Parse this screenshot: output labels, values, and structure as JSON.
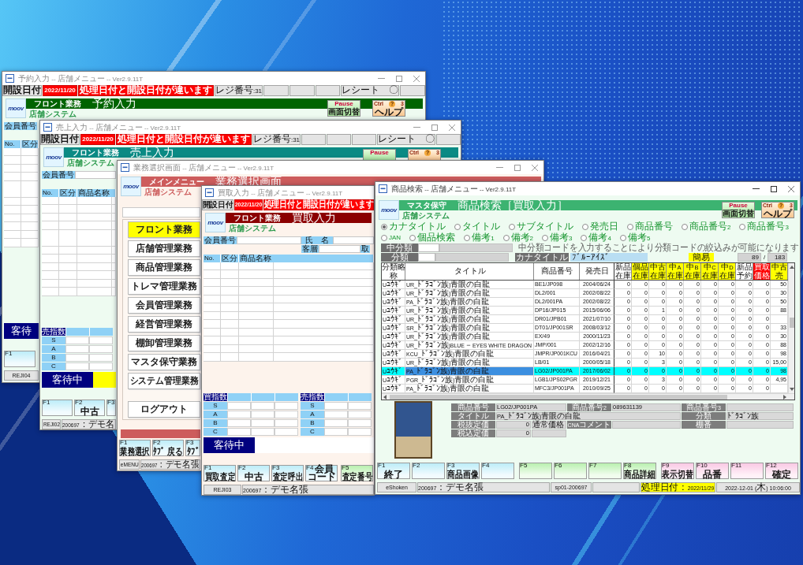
{
  "windows": [
    {
      "kind": "sales",
      "active": false,
      "title": "予約入力 -- 店舗メニュー -- Ver2.9.11T",
      "title_buttons": true,
      "info_bar": [
        {
          "kind": "label",
          "text": "開設日付"
        },
        {
          "kind": "alert",
          "text": "2022/11/20"
        },
        {
          "kind": "alert",
          "text": "処理日付と開設日付が違います"
        },
        {
          "kind": "plain",
          "text": "レジ番号:31"
        },
        {
          "kind": "empty"
        },
        {
          "kind": "empty"
        },
        {
          "kind": "empty"
        },
        {
          "kind": "plain",
          "text": "レシート　〇"
        },
        {
          "kind": "empty"
        }
      ],
      "header": {
        "logo": "moov",
        "module": "フロント業務",
        "screen": "予約入力",
        "system": "店舗システム",
        "color": "#006400",
        "buttons": [
          {
            "kind": "pause",
            "key": "Pause",
            "label": "画面切替"
          },
          {
            "kind": "help",
            "key": "Ctrl",
            "mark": "?",
            "number": "3",
            "label": "ヘルプ"
          }
        ]
      },
      "member_rows": [
        [
          {
            "label": "会員番号",
            "input": false
          }
        ]
      ],
      "table": {
        "columns": [
          "No.",
          "区分"
        ]
      },
      "customer_status": {
        "text": "客待"
      },
      "function_keys": [
        [
          {
            "key": "F1"
          }
        ]
      ],
      "status_bar": [
        {
          "kind": "plain",
          "text": "REJI04"
        }
      ]
    },
    {
      "kind": "sales",
      "active": false,
      "title": "売上入力 -- 店舗メニュー -- Ver2.9.11T",
      "title_buttons": true,
      "info_bar": [
        {
          "kind": "label",
          "text": "開設日付"
        },
        {
          "kind": "alert",
          "text": "2022/11/20"
        },
        {
          "kind": "alert",
          "text": "処理日付と開設日付が違います"
        },
        {
          "kind": "plain",
          "text": "レジ番号:31"
        },
        {
          "kind": "empty"
        },
        {
          "kind": "empty"
        },
        {
          "kind": "empty"
        },
        {
          "kind": "plain",
          "text": "レシート　〇"
        },
        {
          "kind": "empty"
        }
      ],
      "header": {
        "logo": "moov",
        "module": "フロント業務",
        "screen": "売上入力",
        "system": "店舗システム",
        "color": "#0a8a84",
        "buttons": [
          {
            "kind": "pause",
            "key": "Pause"
          },
          {
            "kind": "help",
            "key": "Ctrl",
            "mark": "?",
            "number": "3"
          }
        ]
      },
      "member_rows": [
        [
          {
            "label": "会員番号",
            "input": true
          }
        ]
      ],
      "table": {
        "columns": [
          "No.",
          "区分",
          "商品名称"
        ]
      },
      "indices": [
        {
          "title": "売指数",
          "rows": [
            "S",
            "A",
            "B",
            "C"
          ]
        }
      ],
      "customer_status": {
        "text": "客待中",
        "highlight": true
      },
      "function_keys": [
        [
          {
            "key": "F1"
          },
          {
            "key": "F2",
            "label": "中古"
          },
          {
            "key": "F3"
          }
        ]
      ],
      "status_bar": [
        {
          "kind": "plain",
          "text": "REJI02"
        },
        {
          "kind": "plain",
          "text": "200697：デモ名"
        }
      ]
    },
    {
      "kind": "menu",
      "active": false,
      "title": "業務選択画面 -- 店舗メニュー -- Ver2.9.11T",
      "title_buttons": true,
      "header": {
        "logo": "moov",
        "module": "メインメニュー",
        "screen": "業務選択画面",
        "system": "店舗システム",
        "color": "#cd5c5c"
      },
      "menu": [
        {
          "label": "フロント業務",
          "selected": true
        },
        {
          "label": "店舗管理業務",
          "selected": false
        },
        {
          "label": "商品管理業務",
          "selected": false
        },
        {
          "label": "トレマ管理業務",
          "selected": false
        },
        {
          "label": "会員管理業務",
          "selected": false
        },
        {
          "label": "経営管理業務",
          "selected": false
        },
        {
          "label": "棚卸管理業務",
          "selected": false
        },
        {
          "label": "マスタ保守業務",
          "selected": false
        },
        {
          "label": "システム管理業務",
          "selected": false
        }
      ],
      "logout": {
        "label": "ログアウト"
      },
      "function_keys": [
        [
          {
            "key": "F1",
            "label": "業務選択"
          },
          {
            "key": "F2",
            "label": "ﾀﾌﾞ 戻る"
          },
          {
            "key": "F3",
            "label": "ﾀﾌﾞ"
          }
        ]
      ],
      "status_bar": [
        {
          "kind": "plain",
          "text": "eMENU"
        },
        {
          "kind": "plain",
          "text": "200697：デモ名張"
        }
      ]
    },
    {
      "kind": "purchase",
      "active": false,
      "title": "買取入力 -- 店舗メニュー -- Ver2.9.11T",
      "title_buttons": false,
      "info_bar": [
        {
          "kind": "label",
          "text": "開設日付"
        },
        {
          "kind": "alert",
          "text": "2022/11/20"
        },
        {
          "kind": "alert",
          "text": "処理日付と開設日付が違います"
        }
      ],
      "header": {
        "logo": "moov",
        "module": "フロント業務",
        "screen": "買取入力",
        "system": "店舗システム",
        "color": "#8b0000"
      },
      "member_rows": [
        [
          {
            "label": "会員番号",
            "input": true
          },
          {
            "label": "氏　名",
            "input": true
          }
        ],
        [
          {
            "label": "客層",
            "input": true
          },
          {
            "label": "取",
            "input": false
          }
        ]
      ],
      "table": {
        "columns": [
          "No.",
          "区分",
          "商品名称"
        ]
      },
      "indices": [
        {
          "title": "買指数",
          "rows": [
            "S",
            "A",
            "B",
            "C"
          ]
        },
        {
          "title": "売指数",
          "rows": [
            "S",
            "A",
            "B",
            "C"
          ]
        }
      ],
      "customer_status": {
        "text": "客待中",
        "highlight": false
      },
      "function_keys": [
        [
          {
            "key": "F1",
            "label": "買取査定"
          },
          {
            "key": "F2",
            "label": "中古"
          },
          {
            "key": "F3",
            "label": "査定呼出"
          },
          {
            "key": "F4",
            "lines": [
              "会員",
              "コード"
            ]
          }
        ],
        [
          {
            "key": "F5",
            "label": "査定番号"
          }
        ]
      ],
      "status_bar": [
        {
          "kind": "plain",
          "text": "REJI03"
        },
        {
          "kind": "plain",
          "text": "200697：デモ名張"
        }
      ]
    },
    {
      "kind": "search",
      "active": true,
      "title": "商品検索 -- 店舗メニュー -- Ver2.9.11T",
      "title_buttons": true,
      "header": {
        "logo": "moov",
        "module": "マスタ保守",
        "screen": "商品検索［買取入力］",
        "system": "店舗システム",
        "color": "#3cb371",
        "buttons": [
          {
            "kind": "pause",
            "key": "Pause",
            "label": "画面切替"
          },
          {
            "kind": "help",
            "key": "Ctrl",
            "mark": "?",
            "number": "3",
            "label": "ヘルプ"
          }
        ]
      },
      "search_by": [
        {
          "label": "カナタイトル",
          "selected": true
        },
        {
          "label": "タイトル",
          "selected": false
        },
        {
          "label": "サブタイトル",
          "selected": false
        },
        {
          "label": "発売日",
          "selected": false
        },
        {
          "label": "商品番号",
          "selected": false
        },
        {
          "label": "商品番号2",
          "selected": false
        },
        {
          "label": "商品番号3",
          "selected": false
        },
        {
          "label": "JAN",
          "selected": false
        },
        {
          "label": "個品検索",
          "selected": false
        },
        {
          "label": "備考1",
          "selected": false
        },
        {
          "label": "備考2",
          "selected": false
        },
        {
          "label": "備考3",
          "selected": false
        },
        {
          "label": "備考4",
          "selected": false
        },
        {
          "label": "備考5",
          "selected": false
        }
      ],
      "filters": {
        "middle_class": {
          "label": "中分類",
          "hint": "中分類コードを入力することにより分類コードの絞込みが可能になります"
        },
        "class": {
          "label": "分類"
        },
        "kana_title": {
          "label": "カナタイトル",
          "value": "ﾌﾞﾙｰｱｲｽﾞ"
        },
        "mode": "簡易",
        "count": "89",
        "separator": "/",
        "total": "183"
      },
      "table": {
        "columns": [
          {
            "label": "分類略称",
            "color": "#ffffff"
          },
          {
            "label": "タイトル",
            "color": "#ffffff"
          },
          {
            "label": "商品番号",
            "color": "#ffffff"
          },
          {
            "label": "発売日",
            "color": "#ffffff"
          },
          {
            "label": "新品在庫",
            "color": "#ffffff"
          },
          {
            "label": "個品在庫",
            "color": "#ffff00"
          },
          {
            "label": "中古在庫",
            "color": "#ffff00"
          },
          {
            "label": "中A在庫",
            "color": "#ffff00"
          },
          {
            "label": "中B在庫",
            "color": "#ffff00"
          },
          {
            "label": "中C在庫",
            "color": "#ffff00"
          },
          {
            "label": "中D在庫",
            "color": "#ffff00"
          },
          {
            "label": "新品予約",
            "color": "#ffffff"
          },
          {
            "label": "買取価格",
            "color": "#ff0000"
          },
          {
            "label": "中古売",
            "color": "#ffff00"
          }
        ],
        "rows": [
          {
            "selected": false,
            "cells": [
              "Uﾕｳｷﾞ",
              "UR_ﾄﾞﾗｺﾞﾝ族)青眼の白龍",
              "BE1/JP098",
              "2004/06/24",
              "0",
              "0",
              "0",
              "0",
              "0",
              "0",
              "0",
              "0",
              "0",
              "50"
            ]
          },
          {
            "selected": false,
            "cells": [
              "Uﾕｳｷﾞ",
              "UR_ﾄﾞﾗｺﾞﾝ族)青眼の白龍",
              "DL2/001",
              "2002/08/22",
              "0",
              "0",
              "0",
              "0",
              "0",
              "0",
              "0",
              "0",
              "0",
              "30"
            ]
          },
          {
            "selected": false,
            "cells": [
              "Uﾕｳｷﾞ",
              "PA_ﾄﾞﾗｺﾞﾝ族)青眼の白龍",
              "DL2/001PA",
              "2002/08/22",
              "0",
              "0",
              "0",
              "0",
              "0",
              "0",
              "0",
              "0",
              "0",
              "50"
            ]
          },
          {
            "selected": false,
            "cells": [
              "Uﾕｳｷﾞ",
              "UR_ﾄﾞﾗｺﾞﾝ族)青眼の白龍",
              "DP16/JP015",
              "2015/06/06",
              "0",
              "0",
              "1",
              "0",
              "0",
              "0",
              "0",
              "0",
              "0",
              "88"
            ]
          },
          {
            "selected": false,
            "cells": [
              "Uﾕｳｷﾞ",
              "UR_ﾄﾞﾗｺﾞﾝ族)青眼の白龍",
              "DR01/JPB01",
              "2021/07/10",
              "0",
              "0",
              "0",
              "0",
              "0",
              "0",
              "0",
              "0",
              "0"
            ]
          },
          {
            "selected": false,
            "cells": [
              "Uﾕｳｷﾞ",
              "SR_ﾄﾞﾗｺﾞﾝ族)青眼の白龍",
              "DT01/JP001SR",
              "2008/03/12",
              "0",
              "0",
              "0",
              "0",
              "0",
              "0",
              "0",
              "0",
              "0",
              "33"
            ]
          },
          {
            "selected": false,
            "cells": [
              "Uﾕｳｷﾞ",
              "UR_ﾄﾞﾗｺﾞﾝ族)青眼の白龍",
              "EX/49",
              "2000/11/23",
              "0",
              "0",
              "0",
              "0",
              "0",
              "0",
              "0",
              "0",
              "0",
              "30"
            ]
          },
          {
            "selected": false,
            "cells": [
              "Uﾕｳｷﾞ",
              "UR_ﾄﾞﾗｺﾞﾝ族)BLUE－EYES WHITE DRAGON",
              "JMP/001",
              "2002/12/16",
              "0",
              "0",
              "0",
              "0",
              "0",
              "0",
              "0",
              "0",
              "0",
              "88"
            ]
          },
          {
            "selected": false,
            "cells": [
              "Uﾕｳｷﾞ",
              "KCU_ﾄﾞﾗｺﾞﾝ族)青眼の白龍",
              "JMPR/JP001KCU",
              "2016/04/21",
              "0",
              "0",
              "10",
              "0",
              "0",
              "0",
              "0",
              "0",
              "0",
              "98"
            ]
          },
          {
            "selected": false,
            "cells": [
              "Uﾕｳｷﾞ",
              "UR_ﾄﾞﾗｺﾞﾝ族)青眼の白龍",
              "LB/01",
              "2000/05/18",
              "0",
              "0",
              "3",
              "0",
              "0",
              "0",
              "0",
              "0",
              "0",
              "15,00"
            ]
          },
          {
            "selected": true,
            "cells": [
              "Uﾕｳｷﾞ",
              "PA_ﾄﾞﾗｺﾞﾝ族)青眼の白龍",
              "LG02/JP001PA",
              "2017/06/02",
              "0",
              "0",
              "0",
              "0",
              "0",
              "0",
              "0",
              "0",
              "0",
              "98"
            ]
          },
          {
            "selected": false,
            "cells": [
              "Uﾕｳｷﾞ",
              "PGR_ﾄﾞﾗｺﾞﾝ族)青眼の白龍",
              "LGB1/JPS02PGR",
              "2019/12/21",
              "0",
              "0",
              "3",
              "0",
              "0",
              "0",
              "0",
              "0",
              "0",
              "4,95"
            ]
          },
          {
            "selected": false,
            "cells": [
              "Uﾕｳｷﾞ",
              "PA_ﾄﾞﾗｺﾞﾝ族)青眼の白龍",
              "MFC3/JP001PA",
              "2010/09/25",
              "0",
              "0",
              "0",
              "0",
              "0",
              "0",
              "0",
              "0",
              "0"
            ]
          }
        ]
      },
      "detail": [
        [
          {
            "kind": "text",
            "label": "商品番号",
            "value": "LG02/JP001PA"
          },
          {
            "kind": "text",
            "label": "商品番号2",
            "value": "089631139"
          },
          {
            "kind": "text",
            "label": "商品番号3"
          }
        ],
        [
          {
            "kind": "wide",
            "label": "タイトル",
            "value": "PA_ﾄﾞﾗｺﾞﾝ族)青眼の白龍"
          },
          {
            "kind": "text",
            "label": "分類",
            "value": "ﾄﾞﾗｺﾞﾝ族"
          }
        ],
        [
          {
            "kind": "price",
            "label": "税抜定価",
            "value": "0",
            "note": "通常価格"
          },
          {
            "kind": "text",
            "label": "CNAコメント"
          },
          {
            "kind": "text",
            "label": "棚番"
          }
        ],
        [
          {
            "kind": "price",
            "label": "税込定価",
            "value": "0"
          }
        ]
      ],
      "function_keys": [
        [
          {
            "key": "F1",
            "label": "終了"
          },
          {
            "key": "F2"
          },
          {
            "key": "F3",
            "label": "商品画像"
          },
          {
            "key": "F4"
          }
        ],
        [
          {
            "key": "F5"
          },
          {
            "key": "F6"
          },
          {
            "key": "F7"
          },
          {
            "key": "F8",
            "label": "商品詳細"
          }
        ],
        [
          {
            "key": "F9",
            "label": "表示切替"
          },
          {
            "key": "F10",
            "label": "品番"
          },
          {
            "key": "F11"
          },
          {
            "key": "F12",
            "label": "確定"
          }
        ]
      ],
      "status_bar": [
        {
          "kind": "plain",
          "text": "eShoken"
        },
        {
          "kind": "plain",
          "text": "200697：デモ名張"
        },
        {
          "kind": "plain",
          "text": "sp01-200697"
        },
        {
          "kind": "empty"
        },
        {
          "kind": "highlight",
          "text": "処理日付：2022/11/29"
        },
        {
          "kind": "plain",
          "text": "2022-12-01 (木) 10:06:00"
        }
      ]
    }
  ]
}
